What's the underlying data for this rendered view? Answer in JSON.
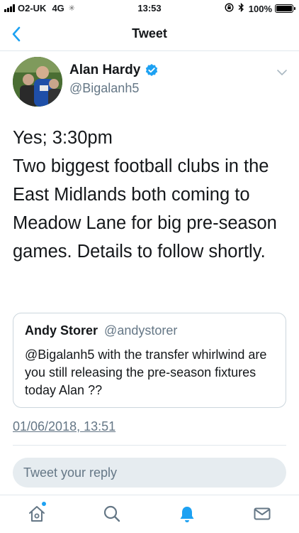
{
  "status_bar": {
    "carrier": "O2-UK",
    "network": "4G",
    "time": "13:53",
    "battery": "100%",
    "battery_level": 1.0
  },
  "nav": {
    "title": "Tweet"
  },
  "tweet": {
    "author_name": "Alan Hardy",
    "author_handle": "@Bigalanh5",
    "text": "Yes; 3:30pm\nTwo biggest football clubs in the East Midlands both coming to Meadow Lane for big pre-season games. Details to follow shortly.",
    "timestamp": "01/06/2018, 13:51"
  },
  "quote": {
    "author_name": "Andy Storer",
    "author_handle": "@andystorer",
    "text": "@Bigalanh5 with the transfer whirlwind are you still releasing the pre-season fixtures today Alan ??"
  },
  "reply": {
    "placeholder": "Tweet your reply"
  },
  "colors": {
    "accent": "#1da1f2",
    "secondary_text": "#657786",
    "border": "#e1e8ed"
  },
  "tabs": [
    {
      "icon": "home-icon",
      "has_badge": true
    },
    {
      "icon": "search-icon"
    },
    {
      "icon": "bell-icon",
      "active": true
    },
    {
      "icon": "mail-icon"
    }
  ]
}
